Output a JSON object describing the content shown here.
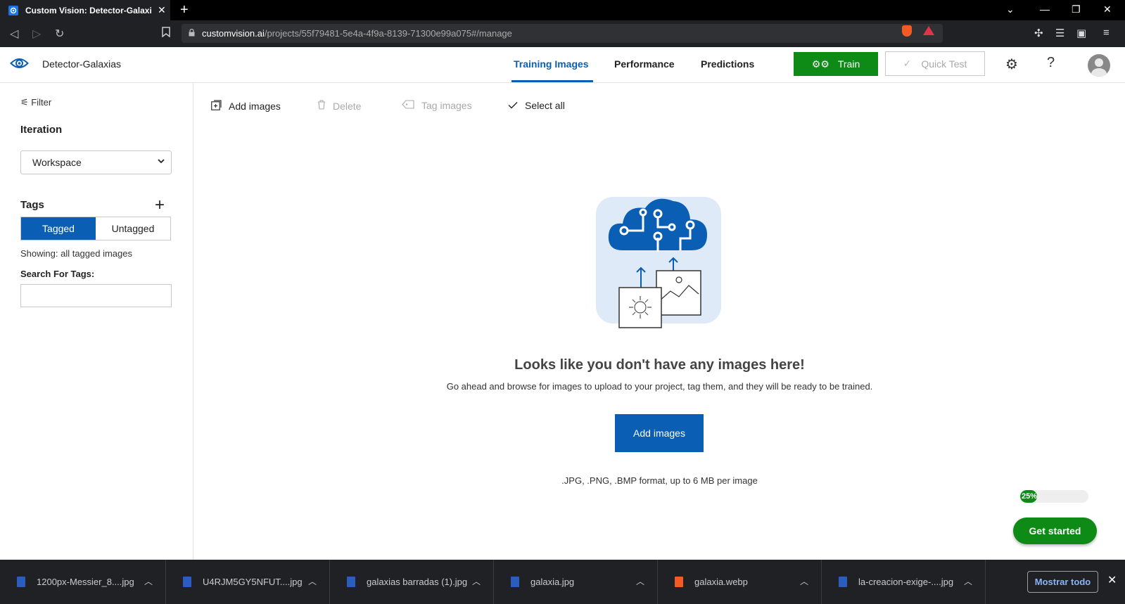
{
  "browser": {
    "tab_title": "Custom Vision: Detector-Galaxias",
    "url_host": "customvision.ai",
    "url_path": "/projects/55f79481-5e4a-4f9a-8139-71300e99a075#/manage"
  },
  "header": {
    "project_name": "Detector-Galaxias",
    "tabs": [
      {
        "label": "Training Images",
        "active": true
      },
      {
        "label": "Performance",
        "active": false
      },
      {
        "label": "Predictions",
        "active": false
      }
    ],
    "train_label": "Train",
    "quick_test_label": "Quick Test",
    "help_label": "?"
  },
  "sidebar": {
    "filter_label": "Filter",
    "iteration_label": "Iteration",
    "iteration_value": "Workspace",
    "tags_label": "Tags",
    "toggle": [
      "Tagged",
      "Untagged"
    ],
    "showing_text": "Showing: all tagged images",
    "search_label": "Search For Tags:",
    "search_value": ""
  },
  "toolbar": {
    "add_images": "Add images",
    "delete": "Delete",
    "tag_images": "Tag images",
    "select_all": "Select all"
  },
  "empty_state": {
    "title": "Looks like you don't have any images here!",
    "subtitle": "Go ahead and browse for images to upload to your project, tag them, and they will be ready to be trained.",
    "button": "Add images",
    "formats": ".JPG, .PNG, .BMP format, up to 6 MB per image"
  },
  "onboarding": {
    "progress_percent": 25,
    "progress_label": "25%",
    "get_started": "Get started"
  },
  "downloads": {
    "items": [
      {
        "name": "1200px-Messier_8....jpg",
        "icon": "image-file-icon"
      },
      {
        "name": "U4RJM5GY5NFUT....jpg",
        "icon": "image-file-icon"
      },
      {
        "name": "galaxias barradas (1).jpg",
        "icon": "image-file-icon"
      },
      {
        "name": "galaxia.jpg",
        "icon": "image-file-icon"
      },
      {
        "name": "galaxia.webp",
        "icon": "brave-file-icon"
      },
      {
        "name": "la-creacion-exige-....jpg",
        "icon": "image-file-icon"
      }
    ],
    "show_all": "Mostrar todo"
  },
  "colors": {
    "accent_blue": "#0a5fb4",
    "train_green": "#0e8a16"
  }
}
